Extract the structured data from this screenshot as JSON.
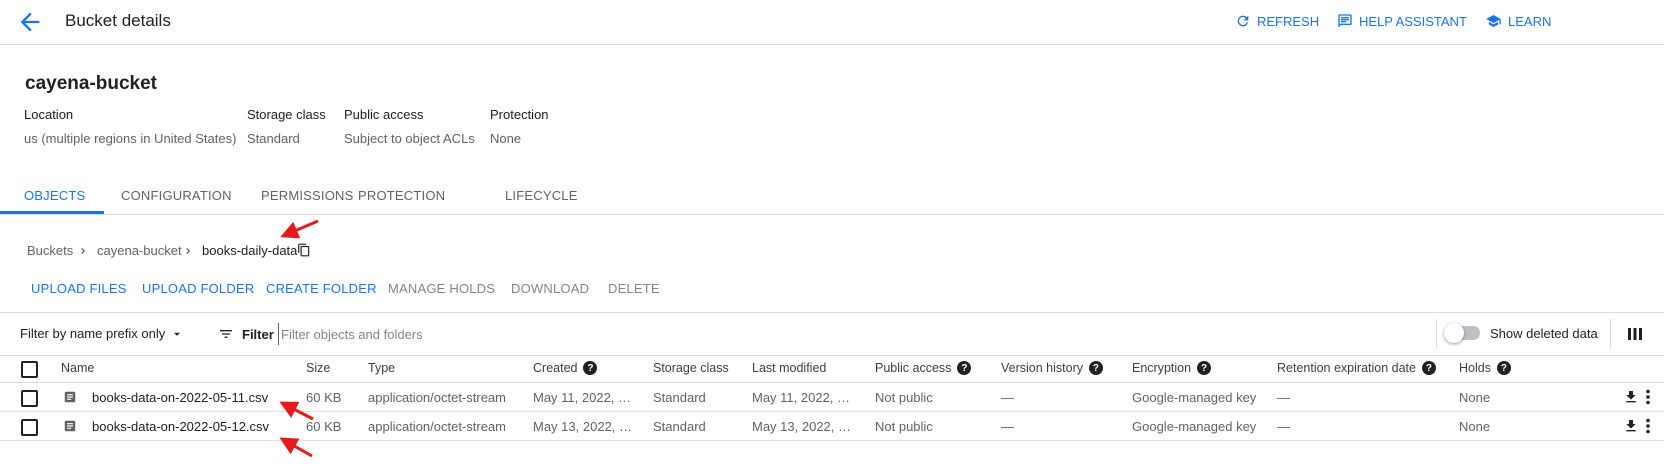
{
  "header": {
    "title": "Bucket details",
    "actions": [
      {
        "label": "REFRESH",
        "icon": "refresh-icon"
      },
      {
        "label": "HELP ASSISTANT",
        "icon": "help-assistant-icon"
      },
      {
        "label": "LEARN",
        "icon": "learn-icon"
      }
    ]
  },
  "bucket": {
    "name": "cayena-bucket",
    "meta": [
      {
        "label": "Location",
        "value": "us (multiple regions in United States)"
      },
      {
        "label": "Storage class",
        "value": "Standard"
      },
      {
        "label": "Public access",
        "value": "Subject to object ACLs"
      },
      {
        "label": "Protection",
        "value": "None"
      }
    ]
  },
  "tabs": [
    {
      "label": "OBJECTS",
      "active": true
    },
    {
      "label": "CONFIGURATION",
      "active": false
    },
    {
      "label": "PERMISSIONS",
      "active": false
    },
    {
      "label": "PROTECTION",
      "active": false
    },
    {
      "label": "LIFECYCLE",
      "active": false
    }
  ],
  "breadcrumb": [
    "Buckets",
    "cayena-bucket",
    "books-daily-data"
  ],
  "actions": [
    {
      "label": "UPLOAD FILES",
      "enabled": true
    },
    {
      "label": "UPLOAD FOLDER",
      "enabled": true
    },
    {
      "label": "CREATE FOLDER",
      "enabled": true
    },
    {
      "label": "MANAGE HOLDS",
      "enabled": false
    },
    {
      "label": "DOWNLOAD",
      "enabled": false
    },
    {
      "label": "DELETE",
      "enabled": false
    }
  ],
  "filter": {
    "mode": "Filter by name prefix only",
    "button": "Filter",
    "placeholder": "Filter objects and folders",
    "show_deleted_label": "Show deleted data",
    "show_deleted": false
  },
  "table": {
    "columns": [
      "Name",
      "Size",
      "Type",
      "Created",
      "Storage class",
      "Last modified",
      "Public access",
      "Version history",
      "Encryption",
      "Retention expiration date",
      "Holds"
    ],
    "rows": [
      {
        "name": "books-data-on-2022-05-11.csv",
        "size": "60 KB",
        "type": "application/octet-stream",
        "created": "May 11, 2022, …",
        "storage_class": "Standard",
        "last_modified": "May 11, 2022, …",
        "public_access": "Not public",
        "version_history": "—",
        "encryption": "Google-managed key",
        "retention": "—",
        "holds": "None"
      },
      {
        "name": "books-data-on-2022-05-12.csv",
        "size": "60 KB",
        "type": "application/octet-stream",
        "created": "May 13, 2022, …",
        "storage_class": "Standard",
        "last_modified": "May 13, 2022, …",
        "public_access": "Not public",
        "version_history": "—",
        "encryption": "Google-managed key",
        "retention": "—",
        "holds": "None"
      }
    ]
  },
  "colors": {
    "accent": "#1a73e8",
    "annotation": "#e8191b"
  }
}
